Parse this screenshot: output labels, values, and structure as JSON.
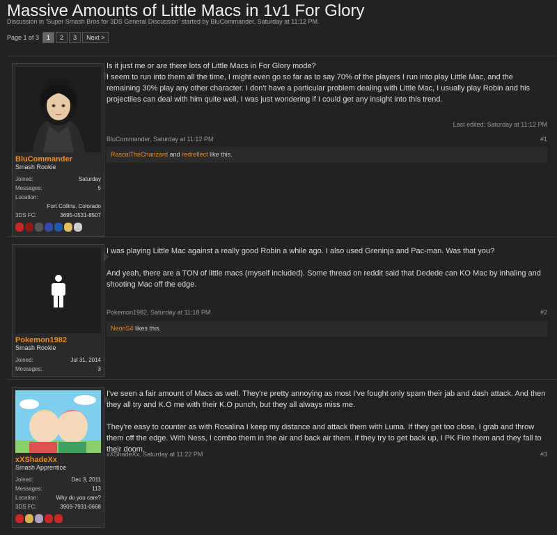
{
  "thread": {
    "title": "Massive Amounts of Little Macs in 1v1 For Glory",
    "subtitle": "Discussion in 'Super Smash Bros for 3DS General Discussion' started by BluCommander, Saturday at 11:12 PM."
  },
  "pager": {
    "label": "Page 1 of 3",
    "pages": [
      "1",
      "2",
      "3"
    ],
    "next": "Next >"
  },
  "posts": [
    {
      "username": "BluCommander",
      "user_title": "Smash Rookie",
      "stats": [
        {
          "k": "Joined:",
          "v": "Saturday"
        },
        {
          "k": "Messages:",
          "v": "5"
        },
        {
          "k": "Location:",
          "v": ""
        },
        {
          "k": "",
          "v": "Fort Collins, Colorado"
        },
        {
          "k": "3DS FC:",
          "v": "3695-0531-8507"
        }
      ],
      "message": [
        "Is it just me or are there lots of Little Macs in For Glory mode?\nI seem to run into them all the time, I might even go so far as to say 70% of the players I run into play Little Mac, and the remaining 30% play any other character. I don't have a particular problem dealing with Little Mac, I usually play Robin and his projectiles can deal with him quite well, I was just wondering if I could get any insight into this trend."
      ],
      "edited": "Last edited: Saturday at 11:12 PM",
      "meta_left": "BluCommander, Saturday at 11:12 PM",
      "number": "#1",
      "likers": [
        "RascalTheCharizard",
        "redreflect"
      ],
      "likes_joiner": " and ",
      "likes_suffix": " like this."
    },
    {
      "username": "Pokemon1982",
      "user_title": "Smash Rookie",
      "stats": [
        {
          "k": "Joined:",
          "v": "Jul 31, 2014"
        },
        {
          "k": "Messages:",
          "v": "3"
        }
      ],
      "message": [
        "I was playing Little Mac against a really good Robin a while ago. I also used Greninja and Pac-man. Was that you?",
        "And yeah, there are a TON of little macs (myself included). Some thread on reddit said that Dedede can KO Mac by inhaling and shooting Mac off the edge."
      ],
      "meta_left": "Pokemon1982, Saturday at 11:18 PM",
      "number": "#2",
      "likers": [
        "NeonS4"
      ],
      "likes_suffix": " likes this."
    },
    {
      "username": "xXShadeXx",
      "user_title": "Smash Apprentice",
      "stats": [
        {
          "k": "Joined:",
          "v": "Dec 3, 2011"
        },
        {
          "k": "Messages:",
          "v": "113"
        },
        {
          "k": "Location:",
          "v": "Why do you care?"
        },
        {
          "k": "3DS FC:",
          "v": "3909-7931-0668"
        }
      ],
      "message": [
        "I've seen a fair amount of Macs as well. They're pretty annoying as most I've fought only spam their jab and dash attack. And then they all try and K.O me with their K.O punch, but they all always miss me.",
        "They're easy to counter as with Rosalina I keep my distance and attack them with Luma. If they get too close, I grab and throw them off the edge. With Ness, I combo them in the air and back air them. If they try to get back up, I PK Fire them and they fall to their doom."
      ],
      "meta_left": "xXShadeXx, Saturday at 11:22 PM",
      "number": "#3"
    }
  ],
  "icons": {
    "post1": [
      "#c62828",
      "#8b1a1a",
      "#555",
      "#3949ab",
      "#1e5aa8",
      "#e0c060",
      "#cccccc"
    ],
    "post3": [
      "#c62828",
      "#d8b050",
      "#b0a0c0",
      "#c62828",
      "#c62828"
    ]
  }
}
